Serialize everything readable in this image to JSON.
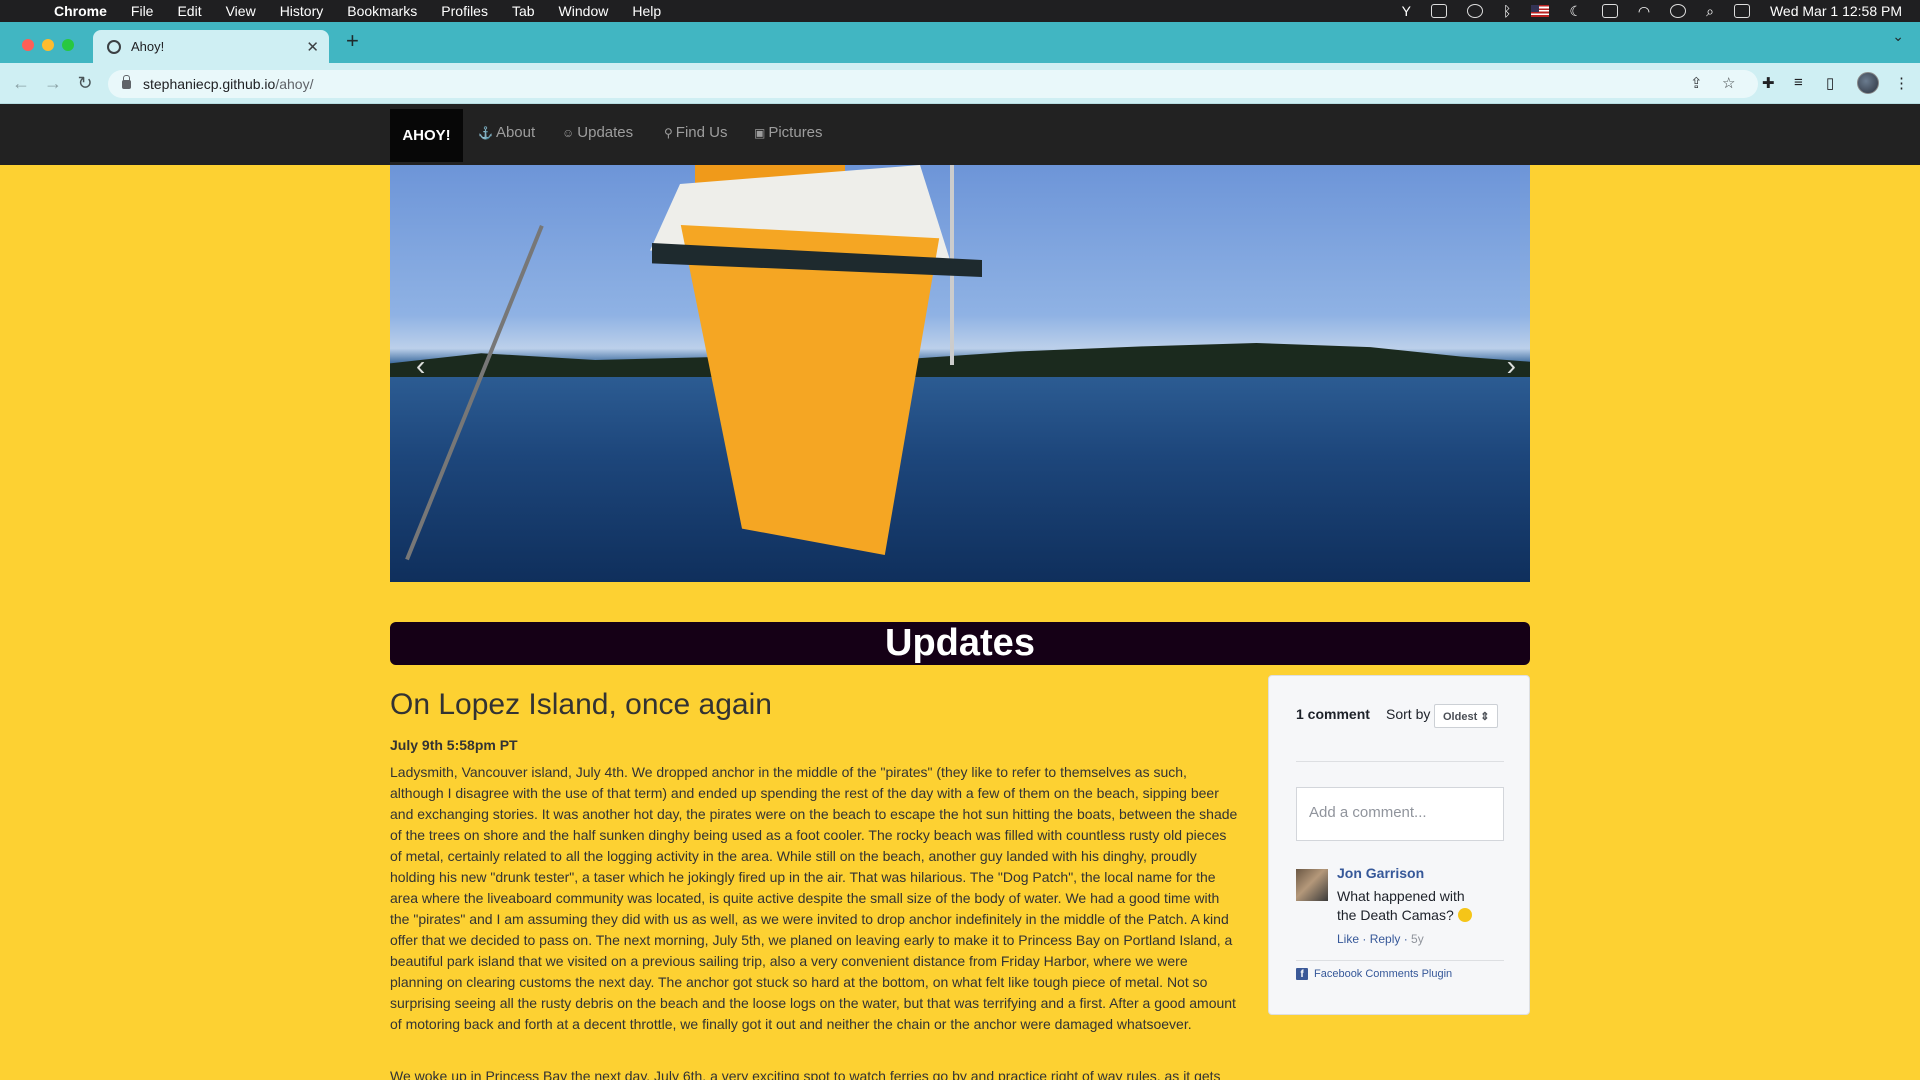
{
  "menubar": {
    "app": "Chrome",
    "items": [
      "File",
      "Edit",
      "View",
      "History",
      "Bookmarks",
      "Profiles",
      "Tab",
      "Window",
      "Help"
    ],
    "clock": "Wed Mar 1  12:58 PM"
  },
  "browser": {
    "tab_title": "Ahoy!",
    "url_host": "stephaniecp.github.io",
    "url_path": "/ahoy/"
  },
  "site": {
    "brand": "AHOY!",
    "nav": [
      {
        "label": "About",
        "icon": "anchor-icon"
      },
      {
        "label": "Updates",
        "icon": "smiley-icon"
      },
      {
        "label": "Find Us",
        "icon": "map-pin-icon"
      },
      {
        "label": "Pictures",
        "icon": "picture-icon"
      }
    ],
    "section_title": "Updates"
  },
  "post": {
    "title": "On Lopez Island, once again",
    "date": "July 9th 5:58pm PT",
    "body": "Ladysmith, Vancouver island, July 4th. We dropped anchor in the middle of the \"pirates\" (they like to refer to themselves as such, although I disagree with the use of that term) and ended up spending the rest of the day with a few of them on the beach, sipping beer and exchanging stories. It was another hot day, the pirates were on the beach to escape the hot sun hitting the boats, between the shade of the trees on shore and the half sunken dinghy being used as a foot cooler. The rocky beach was filled with countless rusty old pieces of metal, certainly related to all the logging activity in the area. While still on the beach, another guy landed with his dinghy, proudly holding his new \"drunk tester\", a taser which he jokingly fired up in the air. That was hilarious. The \"Dog Patch\", the local name for the area where the liveaboard community was located, is quite active despite the small size of the body of water. We had a good time with the \"pirates\" and I am assuming they did with us as well, as we were invited to drop anchor indefinitely in the middle of the Patch. A kind offer that we decided to pass on. The next morning, July 5th, we planed on leaving early to make it to Princess Bay on Portland Island, a beautiful park island that we visited on a previous sailing trip, also a very convenient distance from Friday Harbor, where we were planning on clearing customs the next day. The anchor got stuck so hard at the bottom, on what felt like tough piece of metal. Not so surprising seeing all the rusty debris on the beach and the loose logs on the water, but that was terrifying and a first. After a good amount of motoring back and forth at a decent throttle, we finally got it out and neither the chain or the anchor were damaged whatsoever.",
    "body2": "We woke up in Princess Bay the next day, July 6th, a very exciting spot to watch ferries go by and practice right of way rules, as it gets"
  },
  "comments": {
    "count": "1 comment",
    "sort_label": "Sort by",
    "sort_value": "Oldest",
    "placeholder": "Add a comment...",
    "author": "Jon Garrison",
    "text": "What happened with the Death Camas?",
    "like": "Like",
    "reply": "Reply",
    "age": "5y",
    "plugin": "Facebook Comments Plugin"
  }
}
